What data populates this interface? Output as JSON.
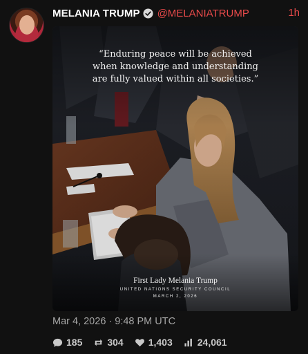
{
  "post": {
    "display_name": "MELANIA TRUMP",
    "handle": "@MELANIATRUMP",
    "time_ago": "1h",
    "verified_icon": "verified-badge-icon",
    "timestamp": "Mar 4, 2026 · 9:48 PM UTC"
  },
  "media": {
    "quote_lines": [
      "“Enduring peace will be achieved",
      "when knowledge and understanding",
      "are fully valued within all societies.”"
    ],
    "caption_name": "First Lady Melania Trump",
    "caption_org": "UNITED NATIONS SECURITY COUNCIL",
    "caption_date": "MARCH 2, 2026"
  },
  "stats": {
    "replies": "185",
    "reposts": "304",
    "likes": "1,403",
    "views": "24,061"
  },
  "colors": {
    "accent": "#e84a4a",
    "background": "#111111",
    "muted_text": "#a5a5a5"
  }
}
